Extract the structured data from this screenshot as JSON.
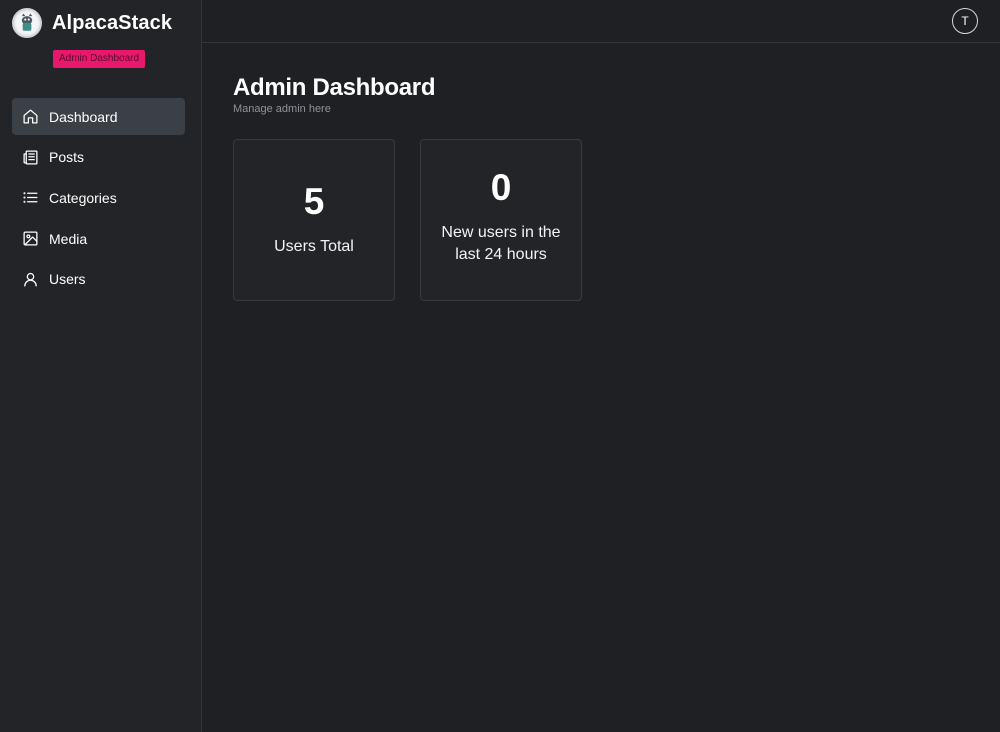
{
  "brand": {
    "name": "AlpacaStack",
    "badge": "Admin Dashboard"
  },
  "sidebar": {
    "items": [
      {
        "label": "Dashboard",
        "icon": "home-icon",
        "active": true
      },
      {
        "label": "Posts",
        "icon": "newspaper-icon",
        "active": false
      },
      {
        "label": "Categories",
        "icon": "list-icon",
        "active": false
      },
      {
        "label": "Media",
        "icon": "image-icon",
        "active": false
      },
      {
        "label": "Users",
        "icon": "user-icon",
        "active": false
      }
    ]
  },
  "topbar": {
    "avatar_initial": "T"
  },
  "main": {
    "title": "Admin Dashboard",
    "subtitle": "Manage admin here",
    "cards": [
      {
        "value": "5",
        "label": "Users Total"
      },
      {
        "value": "0",
        "label": "New users in the last 24 hours"
      }
    ]
  },
  "colors": {
    "accent": "#e8186d",
    "background": "#1f2023",
    "sidebar": "#232427",
    "active_item": "#3b3f46"
  }
}
